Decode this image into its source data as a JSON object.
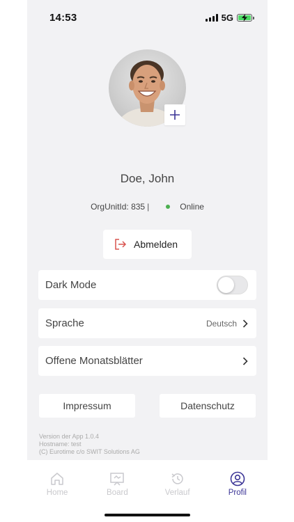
{
  "status_bar": {
    "time": "14:53",
    "network": "5G"
  },
  "profile": {
    "name": "Doe, John",
    "org_unit": "OrgUnitId: 835",
    "separator": "|",
    "presence": "Online",
    "logout_label": "Abmelden"
  },
  "settings": {
    "dark_mode": {
      "label": "Dark Mode",
      "enabled": false
    },
    "language": {
      "label": "Sprache",
      "value": "Deutsch"
    },
    "open_sheets": {
      "label": "Offene Monatsblätter"
    }
  },
  "links": {
    "impressum": "Impressum",
    "datenschutz": "Datenschutz"
  },
  "version_info": {
    "line1": "Version der App 1.0.4",
    "line2": "Hostname: test",
    "line3": "(C) Eurotime c/o SWIT Solutions AG"
  },
  "tabs": [
    {
      "label": "Home",
      "icon": "home-icon",
      "active": false
    },
    {
      "label": "Board",
      "icon": "board-icon",
      "active": false
    },
    {
      "label": "Verlauf",
      "icon": "history-icon",
      "active": false
    },
    {
      "label": "Profil",
      "icon": "profile-icon",
      "active": true
    }
  ],
  "colors": {
    "accent": "#3b3496",
    "online": "#4caf50",
    "logout_icon": "#d9534f"
  }
}
